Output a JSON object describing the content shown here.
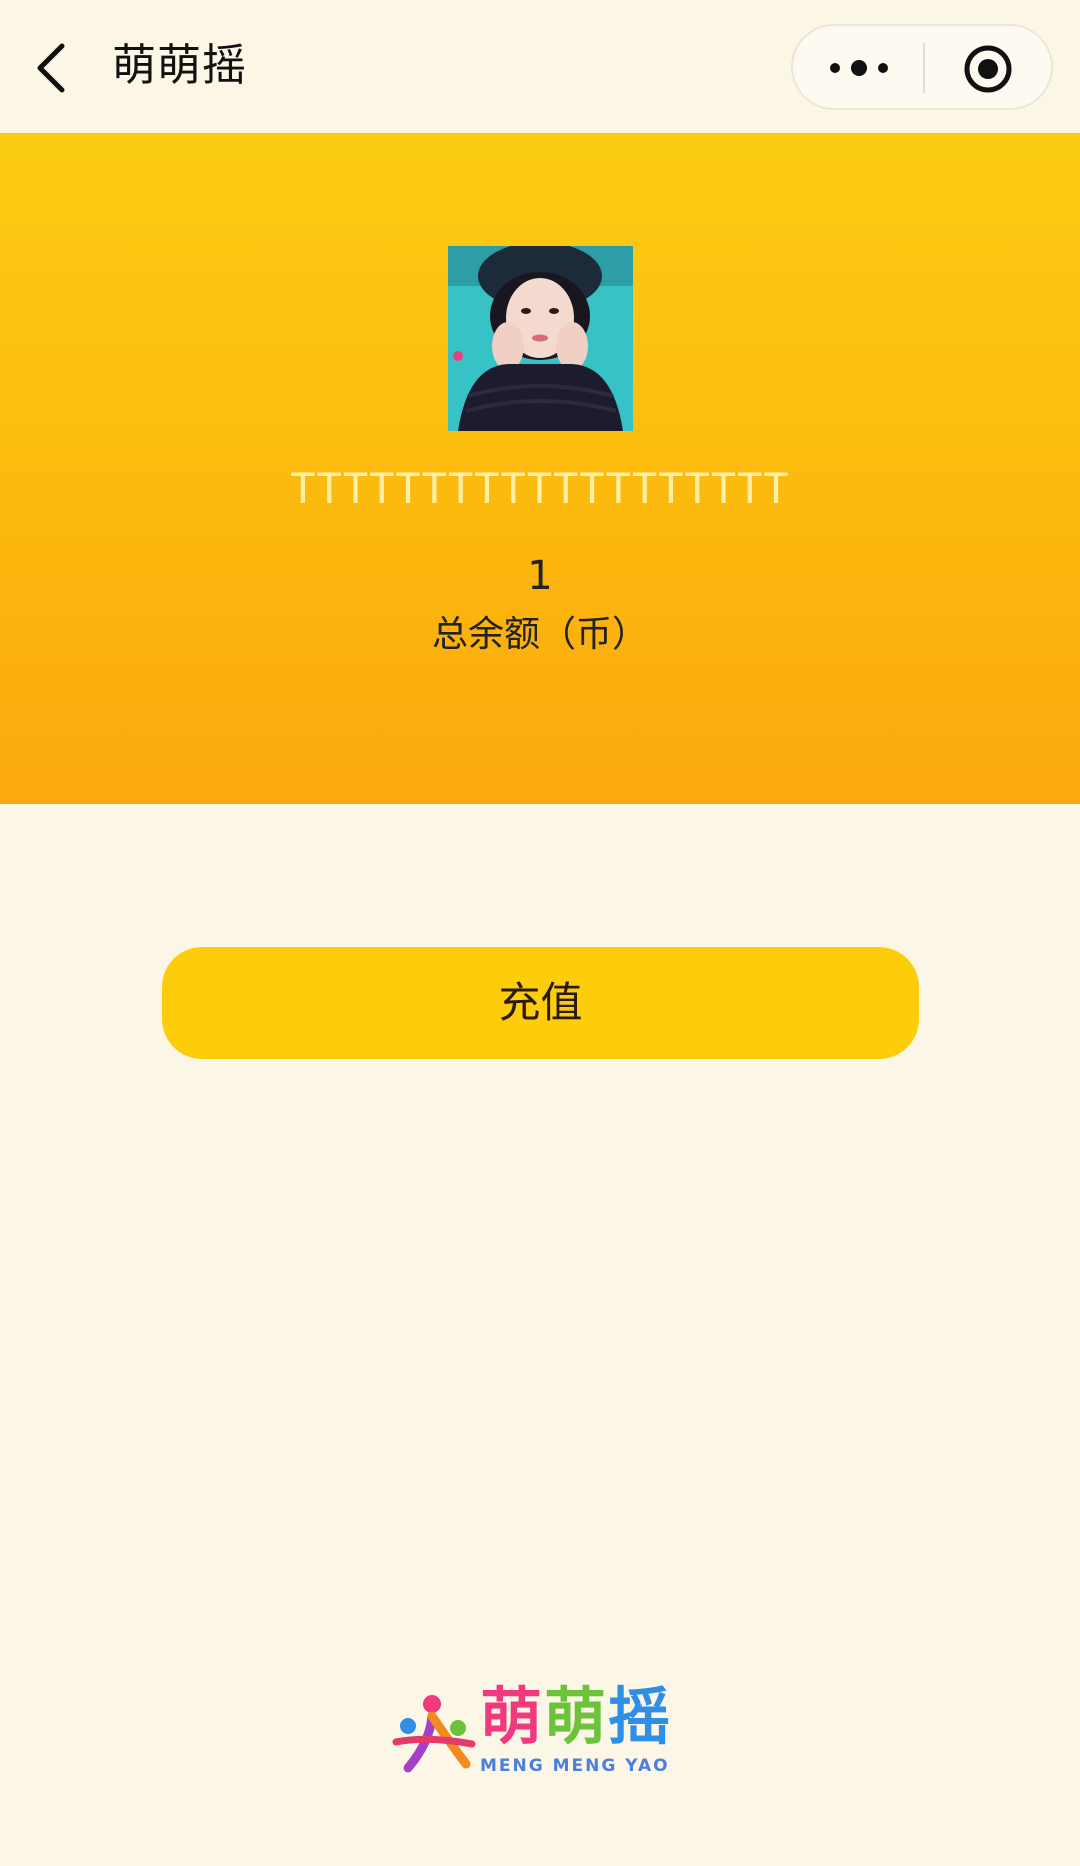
{
  "navbar": {
    "title": "萌萌摇",
    "back_icon": "chevron-left-icon",
    "more_icon": "more-dots-icon",
    "close_icon": "target-circle-icon"
  },
  "profile": {
    "avatar_icon": "user-avatar-photo",
    "nickname": "TTTTTTTTTTTTTTTTTTT",
    "balance_value": "1",
    "balance_label": "总余额（币）"
  },
  "actions": {
    "recharge_label": "充值"
  },
  "footer": {
    "logo_chars": [
      "萌",
      "萌",
      "摇"
    ],
    "logo_sub": "MENG MENG YAO"
  },
  "colors": {
    "hero_top": "#fccc13",
    "hero_bottom": "#fba90d",
    "page_bg": "#fcf6e6",
    "button": "#fdcd0b"
  }
}
